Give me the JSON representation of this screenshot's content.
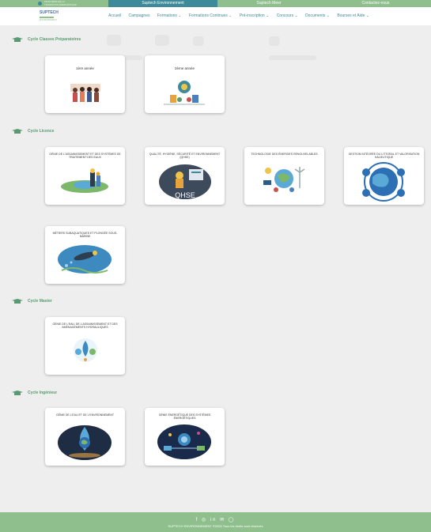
{
  "topbar": {
    "logo_text": "MINISTÈRE DE LA TRANSITION ÉNERGÉTIQUE",
    "env": "Suptech Environnement",
    "mer": "Suptech Meer",
    "contact": "Contactez-nous"
  },
  "nav": {
    "logo": "SUPTECH",
    "logo_sub": "ENVIRONNEMENT",
    "items": [
      "Accueil",
      "Campagnes",
      "Formations ⌄",
      "Formations Continues ⌄",
      "Pré-inscription ⌄",
      "Concours ⌄",
      "Documents ⌄",
      "Bourses et Aide ⌄"
    ]
  },
  "sections": [
    {
      "title": "Cycle Classes Préparatoires",
      "cards": [
        {
          "title": "1ère année"
        },
        {
          "title": "2ème année"
        }
      ]
    },
    {
      "title": "Cycle Licence",
      "cards": [
        {
          "title": "GÉNIE DE L'ASSAINISSEMENT ET DES SYSTÈMES DE TRAITEMENT DES EAUX"
        },
        {
          "title": "QUALITÉ, HYGIÈNE, SÉCURITÉ ET ENVIRONNEMENT (QHSE)",
          "badge": "QHSE"
        },
        {
          "title": "TECHNOLOGIE DES ÉNERGIES RENOUVELABLES"
        },
        {
          "title": "GESTION INTÉGRÉE DU LITTORAL ET VALORISATION HALIEUTIQUE"
        },
        {
          "title": "MÉTIERS SUBAQUATIQUES ET PLONGÉE SOUS-MARINE"
        }
      ]
    },
    {
      "title": "Cycle Master",
      "cards": [
        {
          "title": "GÉNIE DE L'EAU, DE L'ASSAINISSEMENT ET DES AMÉNAGEMENTS HYDRAULIQUES"
        }
      ]
    },
    {
      "title": "Cycle Ingénieur",
      "cards": [
        {
          "title": "GÉNIE DE L'EAU ET DE L'ENVIRONNEMENT"
        },
        {
          "title": "GÉNIE ÉNERGÉTIQUE DES SYSTÈMES ÉNERGÉTIQUES"
        }
      ]
    }
  ],
  "footer": {
    "icons": "f  ◎  in  ✉  ◯",
    "copyright": "SUPTECH ENVIRONNEMENT ©2024 Tous les droits sont réservés"
  },
  "colors": {
    "green": "#8fbf8d",
    "teal": "#3d8a9a",
    "overlay": "#eeeeee"
  }
}
